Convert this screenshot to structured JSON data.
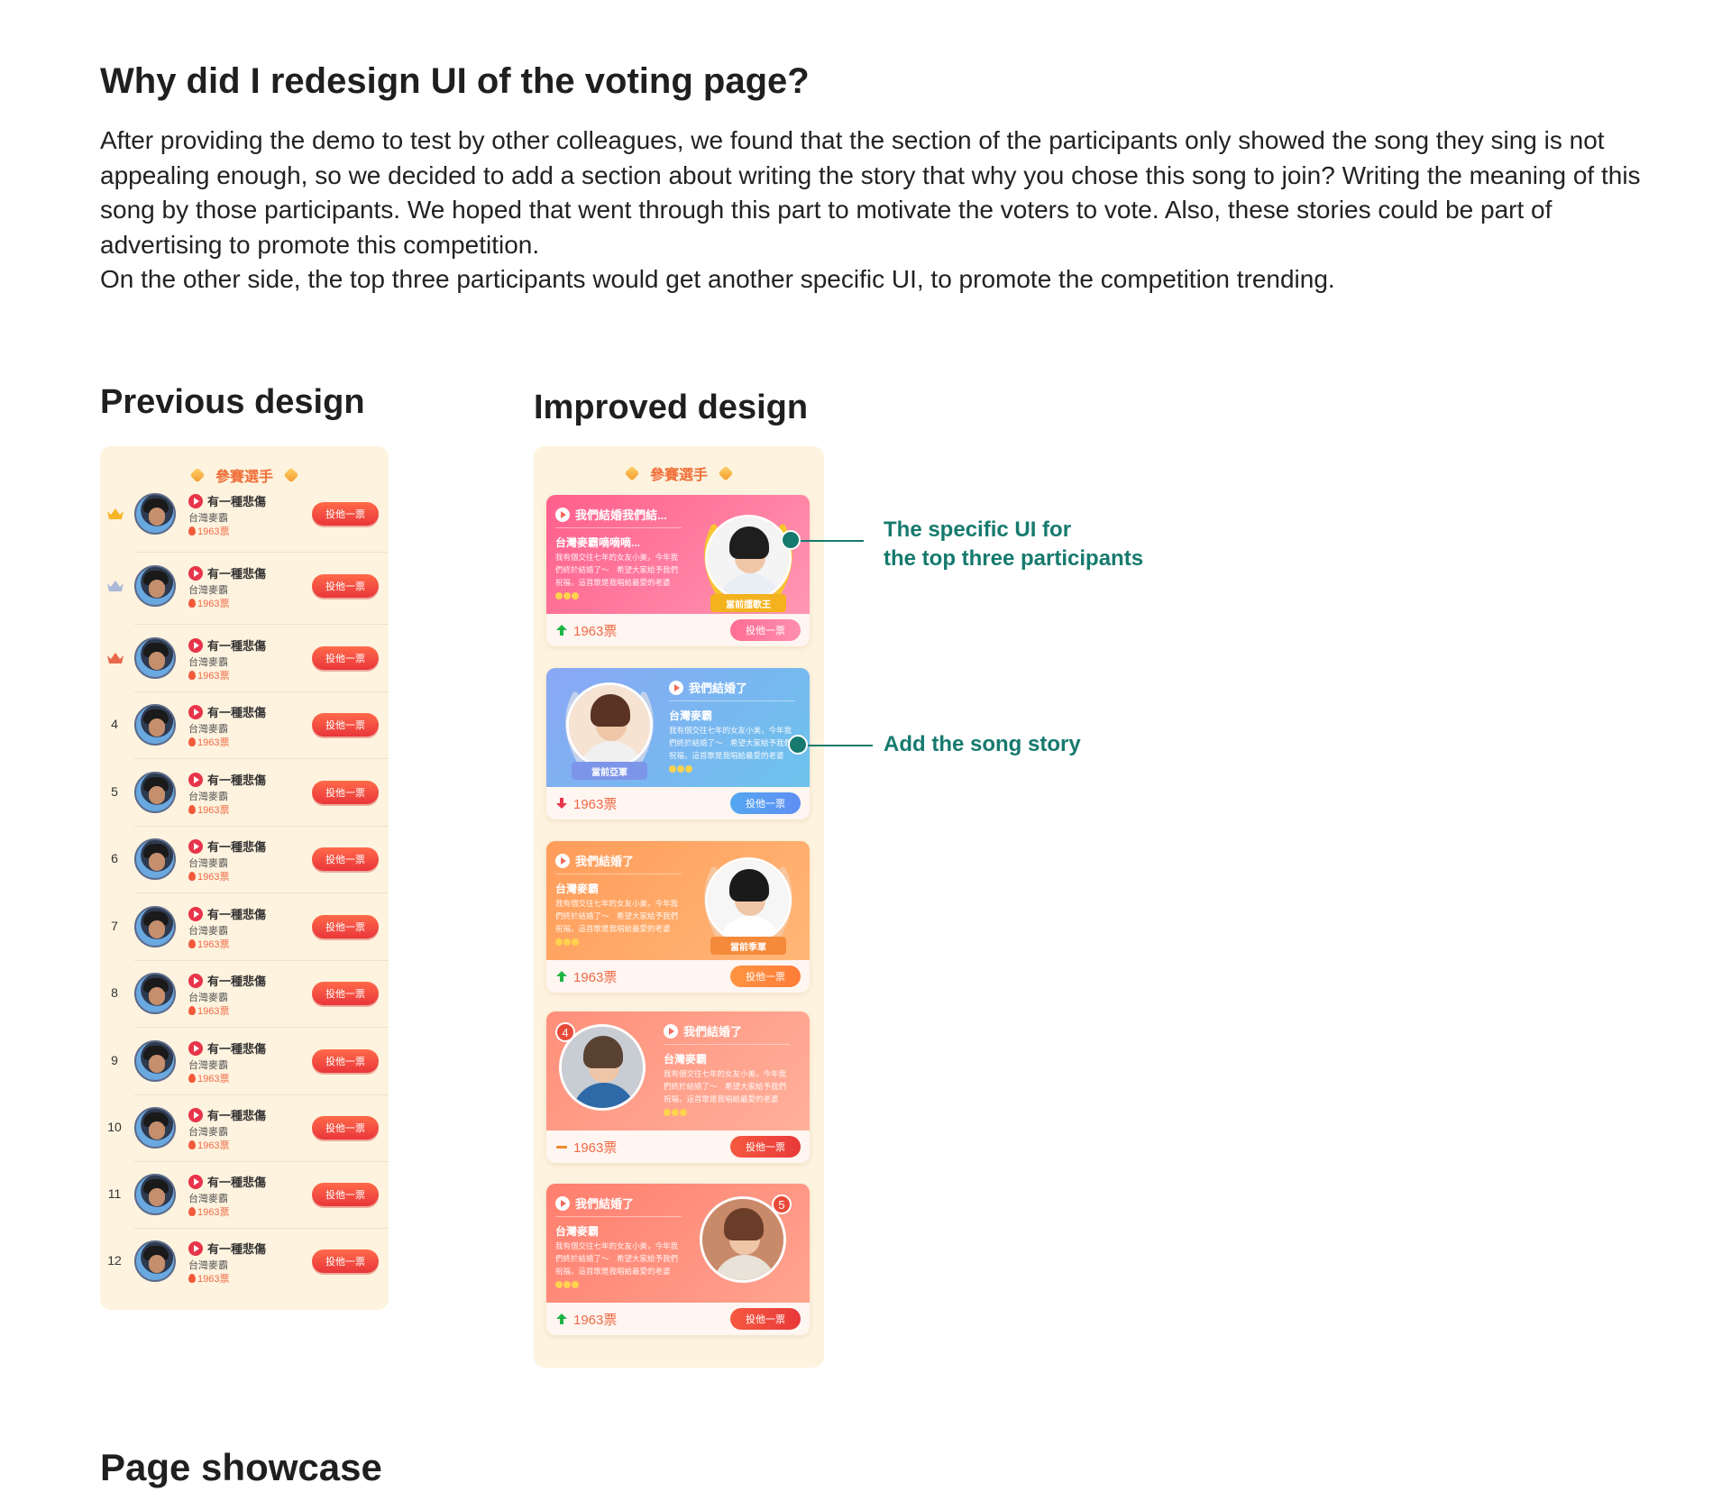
{
  "heading": "Why did I redesign UI of the voting page?",
  "intro": {
    "p1": "After providing the demo to test by other colleagues, we found that the section of the participants only showed the song they sing is not appealing enough, so we decided to add a section about writing the story that why you chose this song to join? Writing the meaning of this song by those participants. We hoped that went through this part to motivate the voters to vote. Also, these stories could be part of advertising to promote this competition.",
    "p2": "On the other side, the top three participants would get another specific UI, to promote the competition trending."
  },
  "previous": {
    "heading": "Previous design",
    "panel_title": "參賽選手",
    "rows": [
      {
        "rank": "",
        "crown": "gold",
        "song": "有一種悲傷",
        "artist": "台灣麥霸",
        "votes": "1963票",
        "button": "投他一票"
      },
      {
        "rank": "",
        "crown": "silver",
        "song": "有一種悲傷",
        "artist": "台灣麥霸",
        "votes": "1963票",
        "button": "投他一票"
      },
      {
        "rank": "",
        "crown": "bronze",
        "song": "有一種悲傷",
        "artist": "台灣麥霸",
        "votes": "1963票",
        "button": "投他一票"
      },
      {
        "rank": "4",
        "song": "有一種悲傷",
        "artist": "台灣麥霸",
        "votes": "1963票",
        "button": "投他一票"
      },
      {
        "rank": "5",
        "song": "有一種悲傷",
        "artist": "台灣麥霸",
        "votes": "1963票",
        "button": "投他一票"
      },
      {
        "rank": "6",
        "song": "有一種悲傷",
        "artist": "台灣麥霸",
        "votes": "1963票",
        "button": "投他一票"
      },
      {
        "rank": "7",
        "song": "有一種悲傷",
        "artist": "台灣麥霸",
        "votes": "1963票",
        "button": "投他一票"
      },
      {
        "rank": "8",
        "song": "有一種悲傷",
        "artist": "台灣麥霸",
        "votes": "1963票",
        "button": "投他一票"
      },
      {
        "rank": "9",
        "song": "有一種悲傷",
        "artist": "台灣麥霸",
        "votes": "1963票",
        "button": "投他一票"
      },
      {
        "rank": "10",
        "song": "有一種悲傷",
        "artist": "台灣麥霸",
        "votes": "1963票",
        "button": "投他一票"
      },
      {
        "rank": "11",
        "song": "有一種悲傷",
        "artist": "台灣麥霸",
        "votes": "1963票",
        "button": "投他一票"
      },
      {
        "rank": "12",
        "song": "有一種悲傷",
        "artist": "台灣麥霸",
        "votes": "1963票",
        "button": "投他一票"
      }
    ]
  },
  "improved": {
    "heading": "Improved design",
    "panel_title": "參賽選手",
    "cards": [
      {
        "title": "我們結婚我們結...",
        "artist": "台灣麥霸嘀嘀嘀...",
        "story": "我有個交往七年的女友小美，今年我們終於結婚了～　希望大家給予我們祝福，這首歌是我唱給最愛的老婆",
        "ribbon": "當前擂歌王",
        "votes": "1963票",
        "trend": "up",
        "button": "投他一票"
      },
      {
        "title": "我們結婚了",
        "artist": "台灣麥霸",
        "story": "我有個交往七年的女友小美，今年我們終於結婚了～　希望大家給予我們祝福，這首歌是我唱給最愛的老婆",
        "ribbon": "當前亞軍",
        "votes": "1963票",
        "trend": "down",
        "button": "投他一票"
      },
      {
        "title": "我們結婚了",
        "artist": "台灣麥霸",
        "story": "我有個交往七年的女友小美，今年我們終於結婚了～　希望大家給予我們祝福，這首歌是我唱給最愛的老婆",
        "ribbon": "當前季軍",
        "votes": "1963票",
        "trend": "up",
        "button": "投他一票"
      },
      {
        "title": "我們結婚了",
        "artist": "台灣麥霸",
        "story": "我有個交往七年的女友小美，今年我們終於結婚了～　希望大家給予我們祝福，這首歌是我唱給最愛的老婆",
        "rank": "4",
        "votes": "1963票",
        "trend": "flat",
        "button": "投他一票"
      },
      {
        "title": "我們結婚了",
        "artist": "台灣麥霸",
        "story": "我有個交往七年的女友小美，今年我們終於結婚了～　希望大家給予我們祝福，這首歌是我唱給最愛的老婆",
        "rank": "5",
        "votes": "1963票",
        "trend": "up",
        "button": "投他一票"
      }
    ]
  },
  "annotations": {
    "top_three_line1": "The specific UI for",
    "top_three_line2": "the top three participants",
    "song_story": "Add the song story"
  },
  "showcase_heading": "Page showcase",
  "colors": {
    "accent_teal": "#167a6e",
    "panel_bg": "#fdf3df",
    "vote_red": "#e9363a",
    "trend_up": "#1fb544",
    "trend_down": "#e8344a",
    "trend_flat": "#f08a2c"
  }
}
